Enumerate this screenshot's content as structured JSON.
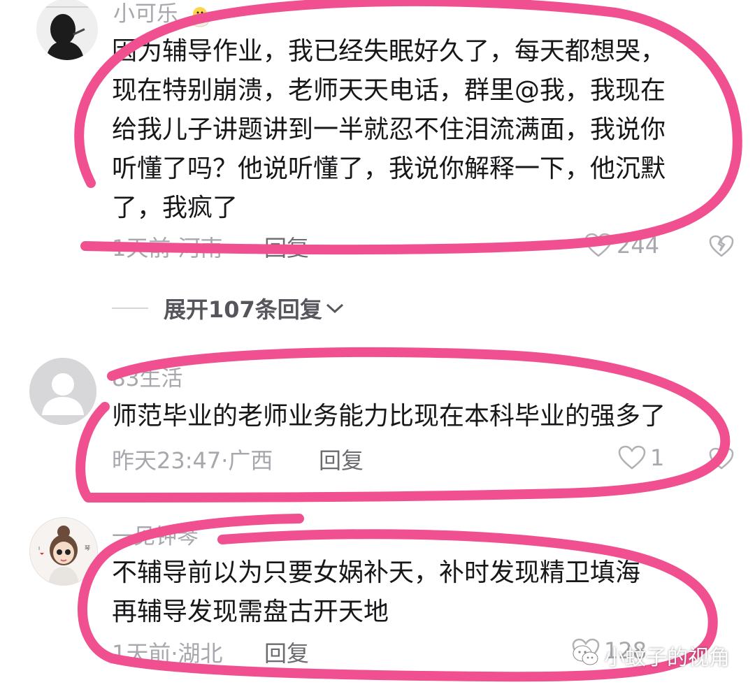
{
  "comments": [
    {
      "username": "小可乐",
      "text": "因为辅导作业，我已经失眠好久了，每天都想哭，\n现在特别崩溃，老师天天电话，群里@我，我现在\n给我儿子讲题讲到一半就忍不住泪流满面，我说你\n听懂了吗？他说听懂了，我说你解释一下，他沉默\n了，我疯了",
      "time_location": "1天前·河南",
      "reply_label": "回复",
      "likes": "244",
      "avatar_icon": "woman-smoking-avatar",
      "badge_icon": "chick-emoji-icon"
    },
    {
      "username": "83生活",
      "text": "师范毕业的老师业务能力比现在本科毕业的强多了",
      "time_location": "昨天23:47·广西",
      "reply_label": "回复",
      "likes": "1",
      "avatar_icon": "default-person-avatar"
    },
    {
      "username": "一见钟琴",
      "text": "不辅导前以为只要女娲补天，补时发现精卫填海\n再辅导发现需盘古开天地",
      "time_location": "1天前·湖北",
      "reply_label": "回复",
      "likes": "128",
      "avatar_icon": "cartoon-girl-avatar"
    }
  ],
  "expand": {
    "label": "展开107条回复"
  },
  "watermark": {
    "text": "小蚊子的视角",
    "icon": "wechat-icon"
  },
  "colors": {
    "highlight": "#f0508f",
    "meta_gray": "#a7a7ad",
    "text": "#17171a"
  }
}
